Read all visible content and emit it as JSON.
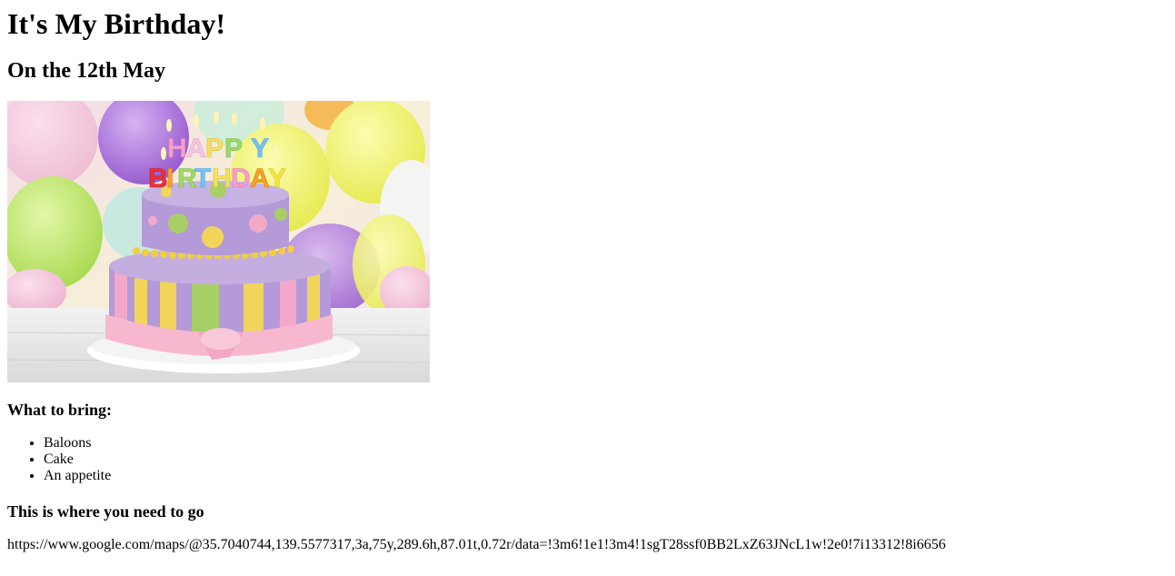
{
  "page": {
    "title": "It's My Birthday!",
    "subtitle": "On the 12th May"
  },
  "image": {
    "cake_text_line1": "HAPPY",
    "cake_text_line2": "BIRTHDAY",
    "colors": {
      "frosting_purple": "#b49ad8",
      "stripe_pink": "#f2a9c9",
      "stripe_yellow": "#f2d45a",
      "stripe_green": "#a8cf66",
      "ribbon_pink": "#f7b8cf",
      "balloon_purple": "#a16ad6",
      "balloon_yellow": "#eef06a",
      "balloon_green": "#b9e567",
      "table": "#e9e9ea"
    }
  },
  "bring": {
    "heading": "What to bring:",
    "items": [
      "Baloons",
      "Cake",
      "An appetite"
    ]
  },
  "directions": {
    "heading": "This is where you need to go",
    "url": "https://www.google.com/maps/@35.7040744,139.5577317,3a,75y,289.6h,87.01t,0.72r/data=!3m6!1e1!3m4!1sgT28ssf0BB2LxZ63JNcL1w!2e0!7i13312!8i6656"
  }
}
